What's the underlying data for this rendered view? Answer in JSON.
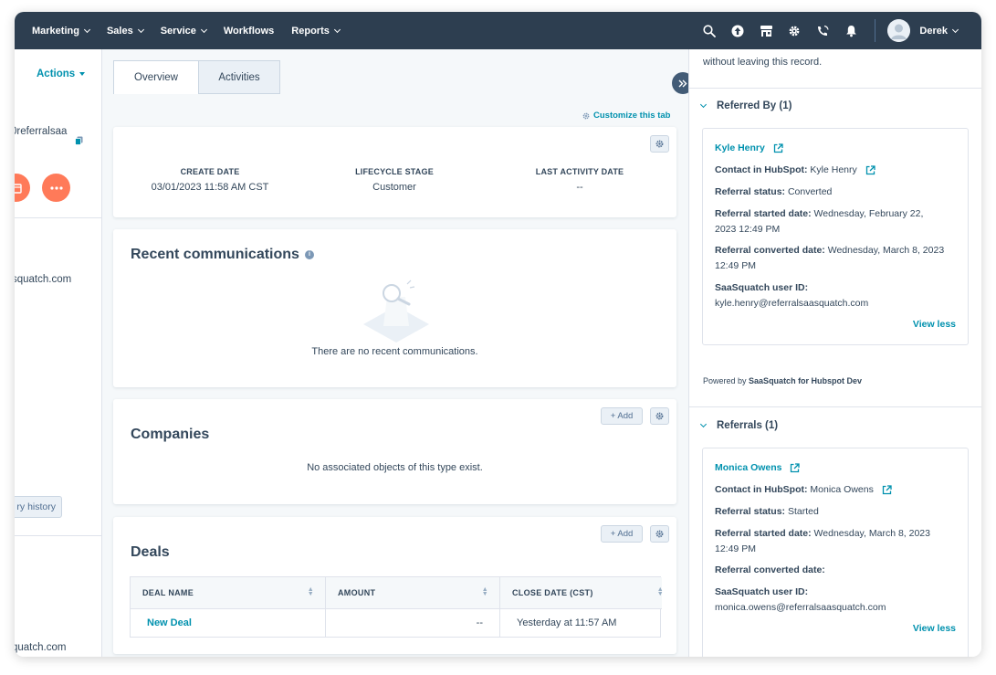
{
  "nav": {
    "items": [
      "Marketing",
      "Sales",
      "Service",
      "Workflows",
      "Reports"
    ],
    "user_name": "Derek"
  },
  "left": {
    "actions_label": "Actions",
    "name_partial": "0referralsaa",
    "email_partial_1": "squatch.com",
    "history_label": "ry history",
    "email_partial_2": "quatch.com"
  },
  "tabs": {
    "overview": "Overview",
    "activities": "Activities"
  },
  "customize_label": "Customize this tab",
  "summary": {
    "create_date_label": "CREATE DATE",
    "create_date_value": "03/01/2023 11:58 AM CST",
    "lifecycle_label": "LIFECYCLE STAGE",
    "lifecycle_value": "Customer",
    "last_activity_label": "LAST ACTIVITY DATE",
    "last_activity_value": "--"
  },
  "communications": {
    "title": "Recent communications",
    "empty": "There are no recent communications."
  },
  "companies": {
    "title": "Companies",
    "add_label": "+ Add",
    "empty": "No associated objects of this type exist."
  },
  "deals": {
    "title": "Deals",
    "add_label": "+ Add",
    "columns": [
      "DEAL NAME",
      "AMOUNT",
      "CLOSE DATE (CST)"
    ],
    "rows": [
      {
        "name": "New Deal",
        "amount": "--",
        "close_date": "Yesterday at 11:57 AM"
      }
    ]
  },
  "right": {
    "top_text": "without leaving this record.",
    "referred_by": {
      "header": "Referred By (1)",
      "name": "Kyle Henry",
      "contact_label": "Contact in HubSpot:",
      "contact_value": "Kyle Henry",
      "status_label": "Referral status:",
      "status_value": "Converted",
      "started_label": "Referral started date:",
      "started_value_1": "Wednesday, February 22,",
      "started_value_2": "2023 12:49 PM",
      "converted_label": "Referral converted date:",
      "converted_value_1": "Wednesday, March 8, 2023",
      "converted_value_2": "12:49 PM",
      "userid_label": "SaaSquatch user ID:",
      "userid_value": "kyle.henry@referralsaasquatch.com",
      "view_less": "View less"
    },
    "powered_prefix": "Powered by",
    "powered_name": "SaaSquatch for Hubspot Dev",
    "referrals": {
      "header": "Referrals (1)",
      "name": "Monica Owens",
      "contact_label": "Contact in HubSpot:",
      "contact_value": "Monica Owens",
      "status_label": "Referral status:",
      "status_value": "Started",
      "started_label": "Referral started date:",
      "started_value_1": "Wednesday, March 8, 2023",
      "started_value_2": "12:49 PM",
      "converted_label": "Referral converted date:",
      "userid_label": "SaaSquatch user ID:",
      "userid_value": "monica.owens@referralsaasquatch.com",
      "view_less": "View less"
    }
  },
  "colors": {
    "nav_bg": "#2d3e50",
    "link": "#0091ae",
    "orange": "#ff7a59"
  }
}
